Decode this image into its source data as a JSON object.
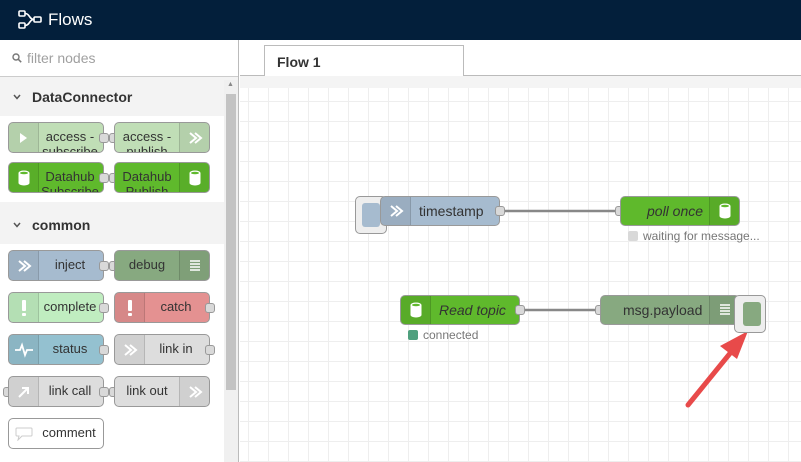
{
  "header": {
    "title": "Flows"
  },
  "palette": {
    "search_placeholder": "filter nodes",
    "categories": [
      {
        "name": "DataConnector",
        "nodes": [
          {
            "label": "access -",
            "label2": "subscribe",
            "color": "#c0deb6"
          },
          {
            "label": "access -",
            "label2": "publish",
            "color": "#c0deb6"
          },
          {
            "label": "Datahub",
            "label2": "Subscribe",
            "color": "#5fb92c"
          },
          {
            "label": "Datahub",
            "label2": "Publish",
            "color": "#5fb92c"
          }
        ]
      },
      {
        "name": "common",
        "nodes": [
          {
            "label": "inject",
            "color": "#a6bbcf"
          },
          {
            "label": "debug",
            "color": "#87a980"
          },
          {
            "label": "complete",
            "color": "#c0edc0"
          },
          {
            "label": "catch",
            "color": "#e49191"
          },
          {
            "label": "status",
            "color": "#94c1d0"
          },
          {
            "label": "link in",
            "color": "#dddddd"
          },
          {
            "label": "link call",
            "color": "#dddddd"
          },
          {
            "label": "link out",
            "color": "#dddddd"
          },
          {
            "label": "comment",
            "color": "#ffffff"
          }
        ]
      }
    ]
  },
  "tabs": [
    {
      "label": "Flow 1"
    }
  ],
  "workspace": {
    "nodes": {
      "timestamp": {
        "label": "timestamp",
        "color": "#a6bbcf"
      },
      "poll_once": {
        "label": "poll once",
        "color": "#5fb92c"
      },
      "read_topic": {
        "label": "Read topic",
        "color": "#5fb92c"
      },
      "msg_payload": {
        "label": "msg.payload",
        "color": "#87a980"
      }
    },
    "statuses": {
      "poll_once": {
        "text": "waiting for message...",
        "color": "#d9d9d9"
      },
      "read_topic": {
        "text": "connected",
        "color": "#4fa07e"
      }
    },
    "annotation_color": "#e84a4a"
  }
}
